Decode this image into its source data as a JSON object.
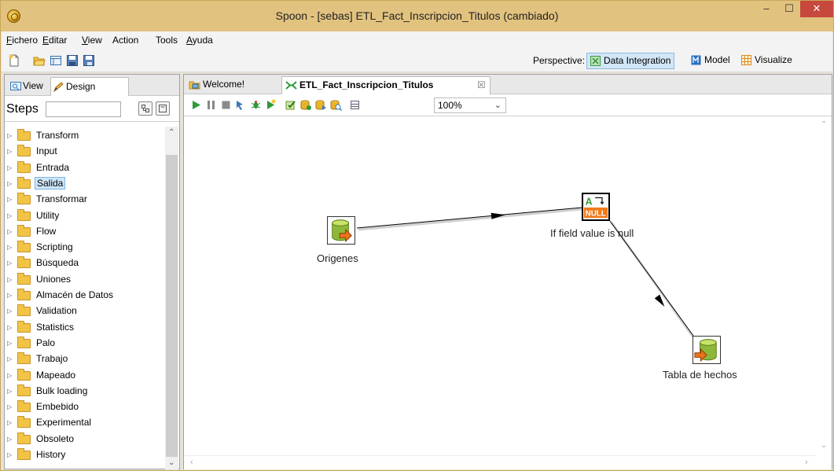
{
  "window": {
    "title": "Spoon - [sebas] ETL_Fact_Inscripcion_Titulos (cambiado)",
    "minimize": "‒",
    "maximize": "☐",
    "close": "✕"
  },
  "menu": [
    {
      "first": "F",
      "rest": "ichero"
    },
    {
      "first": "E",
      "rest": "ditar"
    },
    {
      "first": "V",
      "rest": "iew"
    },
    {
      "first": "",
      "rest": "Action"
    },
    {
      "first": "",
      "rest": "Tools"
    },
    {
      "first": "A",
      "rest": "yuda"
    }
  ],
  "toolbar": {
    "icons": [
      "new-file-icon",
      "open-folder-icon",
      "explore-repository-icon",
      "save-icon",
      "save-as-icon"
    ],
    "perspective_label": "Perspective:",
    "perspectives": [
      {
        "label": "Data Integration",
        "active": true,
        "icon": "data-integration-icon",
        "color": "#3a9a3a"
      },
      {
        "label": "Model",
        "active": false,
        "icon": "model-icon",
        "color": "#2a6fbf"
      },
      {
        "label": "Visualize",
        "active": false,
        "icon": "visualize-icon",
        "color": "#d88a22"
      }
    ]
  },
  "left_panel": {
    "tabs": [
      {
        "label": "View",
        "icon": "view-icon"
      },
      {
        "label": "Design",
        "icon": "design-pencil-icon",
        "active": true
      }
    ],
    "steps_label": "Steps",
    "search_value": "",
    "step_folders": [
      "Transform",
      "Input",
      "Entrada",
      "Salida",
      "Transformar",
      "Utility",
      "Flow",
      "Scripting",
      "Búsqueda",
      "Uniones",
      "Almacén de Datos",
      "Validation",
      "Statistics",
      "Palo",
      "Trabajo",
      "Mapeado",
      "Bulk loading",
      "Embebido",
      "Experimental",
      "Obsoleto",
      "History"
    ],
    "selected_folder": "Salida"
  },
  "editor": {
    "tabs": [
      {
        "label": "Welcome!",
        "icon": "welcome-icon",
        "active": false
      },
      {
        "label": "ETL_Fact_Inscripcion_Titulos",
        "icon": "transformation-icon",
        "active": true,
        "close": "☒"
      }
    ],
    "canvas_toolbar": {
      "icons": [
        "run-icon",
        "pause-icon",
        "stop-icon",
        "preview-icon",
        "debug-icon",
        "replay-icon",
        "verify-icon",
        "impact-icon",
        "sql-icon",
        "explore-db-icon",
        "show-results-icon"
      ],
      "zoom": "100%"
    },
    "steps": [
      {
        "id": "origenes",
        "label": "Origenes",
        "type": "table-input"
      },
      {
        "id": "ifnull",
        "label": "If field value is null",
        "type": "if-null"
      },
      {
        "id": "tabla",
        "label": "Tabla de hechos",
        "type": "table-output"
      }
    ],
    "hops": [
      {
        "from": "Origenes",
        "to": "If field value is null"
      },
      {
        "from": "If field value is null",
        "to": "Tabla de hechos"
      }
    ]
  }
}
